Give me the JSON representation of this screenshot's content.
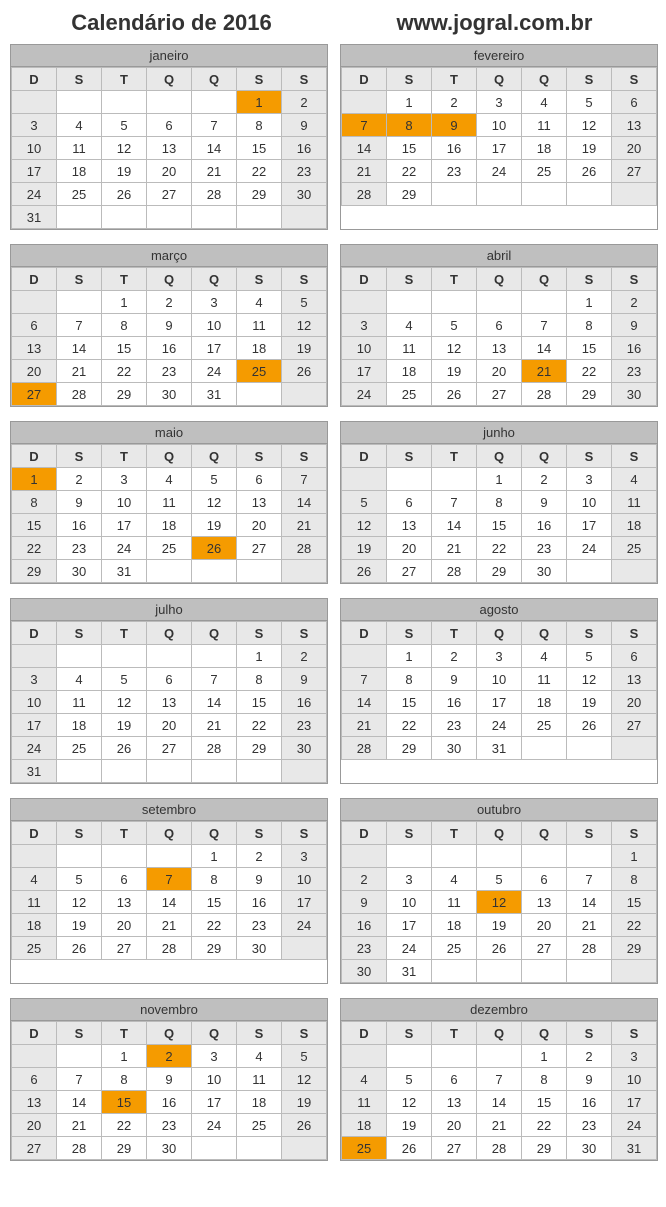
{
  "header": {
    "title": "Calendário de 2016",
    "site": "www.jogral.com.br"
  },
  "dow": [
    "D",
    "S",
    "T",
    "Q",
    "Q",
    "S",
    "S"
  ],
  "months": [
    {
      "name": "janeiro",
      "start": 5,
      "days": 31,
      "holidays": [
        1
      ]
    },
    {
      "name": "fevereiro",
      "start": 1,
      "days": 29,
      "holidays": [
        7,
        8,
        9
      ]
    },
    {
      "name": "março",
      "start": 2,
      "days": 31,
      "holidays": [
        25,
        27
      ]
    },
    {
      "name": "abril",
      "start": 5,
      "days": 30,
      "holidays": [
        21
      ]
    },
    {
      "name": "maio",
      "start": 0,
      "days": 31,
      "holidays": [
        1,
        26
      ]
    },
    {
      "name": "junho",
      "start": 3,
      "days": 30,
      "holidays": []
    },
    {
      "name": "julho",
      "start": 5,
      "days": 31,
      "holidays": []
    },
    {
      "name": "agosto",
      "start": 1,
      "days": 31,
      "holidays": []
    },
    {
      "name": "setembro",
      "start": 4,
      "days": 30,
      "holidays": [
        7
      ]
    },
    {
      "name": "outubro",
      "start": 6,
      "days": 31,
      "holidays": [
        12
      ]
    },
    {
      "name": "novembro",
      "start": 2,
      "days": 30,
      "holidays": [
        2,
        15
      ]
    },
    {
      "name": "dezembro",
      "start": 4,
      "days": 31,
      "holidays": [
        25
      ]
    }
  ]
}
